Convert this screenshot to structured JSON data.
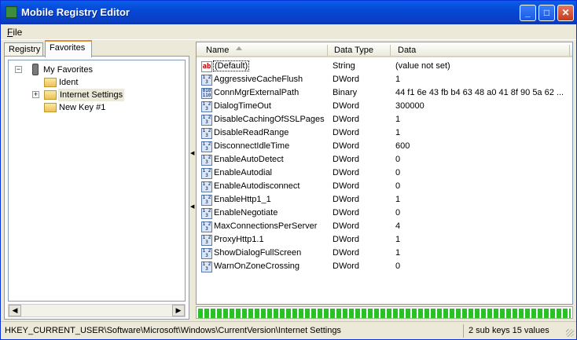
{
  "window": {
    "title": "Mobile Registry Editor",
    "minimize": "_",
    "maximize": "□",
    "close": "✕"
  },
  "menu": {
    "file": "File"
  },
  "tabs": [
    {
      "label": "Registry"
    },
    {
      "label": "Favorites",
      "active": true
    }
  ],
  "tree": {
    "root": {
      "label": "My Favorites",
      "expander": "−"
    },
    "children": [
      {
        "label": "Ident"
      },
      {
        "label": "Internet Settings",
        "expander": "+",
        "selected": true
      },
      {
        "label": "New Key #1"
      }
    ]
  },
  "list": {
    "columns": {
      "name": "Name",
      "type": "Data Type",
      "data": "Data"
    },
    "rows": [
      {
        "icon": "ab",
        "name": "(Default)",
        "type": "String",
        "data": "(value not set)"
      },
      {
        "icon": "dword",
        "name": "AggressiveCacheFlush",
        "type": "DWord",
        "data": "1"
      },
      {
        "icon": "binary",
        "name": "ConnMgrExternalPath",
        "type": "Binary",
        "data": "44 f1 6e 43 fb b4 63 48 a0 41 8f 90 5a 62 ..."
      },
      {
        "icon": "dword",
        "name": "DialogTimeOut",
        "type": "DWord",
        "data": "300000"
      },
      {
        "icon": "dword",
        "name": "DisableCachingOfSSLPages",
        "type": "DWord",
        "data": "1"
      },
      {
        "icon": "dword",
        "name": "DisableReadRange",
        "type": "DWord",
        "data": "1"
      },
      {
        "icon": "dword",
        "name": "DisconnectIdleTime",
        "type": "DWord",
        "data": "600"
      },
      {
        "icon": "dword",
        "name": "EnableAutoDetect",
        "type": "DWord",
        "data": "0"
      },
      {
        "icon": "dword",
        "name": "EnableAutodial",
        "type": "DWord",
        "data": "0"
      },
      {
        "icon": "dword",
        "name": "EnableAutodisconnect",
        "type": "DWord",
        "data": "0"
      },
      {
        "icon": "dword",
        "name": "EnableHttp1_1",
        "type": "DWord",
        "data": "1"
      },
      {
        "icon": "dword",
        "name": "EnableNegotiate",
        "type": "DWord",
        "data": "0"
      },
      {
        "icon": "dword",
        "name": "MaxConnectionsPerServer",
        "type": "DWord",
        "data": "4"
      },
      {
        "icon": "dword",
        "name": "ProxyHttp1.1",
        "type": "DWord",
        "data": "1"
      },
      {
        "icon": "dword",
        "name": "ShowDialogFullScreen",
        "type": "DWord",
        "data": "1"
      },
      {
        "icon": "dword",
        "name": "WarnOnZoneCrossing",
        "type": "DWord",
        "data": "0"
      }
    ]
  },
  "progress": {
    "value": 1.0,
    "color": "#25c425"
  },
  "status": {
    "path": "HKEY_CURRENT_USER\\Software\\Microsoft\\Windows\\CurrentVersion\\Internet Settings",
    "summary": "2 sub keys 15 values"
  },
  "colors": {
    "titlebar": "#0548d6",
    "accent": "#e68b2c",
    "selection": "#c1d2ee"
  }
}
